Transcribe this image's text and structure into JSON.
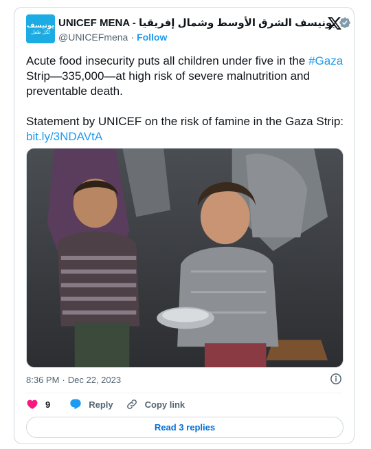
{
  "author": {
    "avatar": {
      "top_text": "يونيسف",
      "bottom_text": "لكل طفل",
      "logo_glyph": "☺",
      "bg_color": "#1cabe2"
    },
    "display_name": "UNICEF MENA - يونيسف الشرق الأوسط وشمال إفريقيا",
    "verified_icon": "verified-badge-icon",
    "handle": "@UNICEFmena",
    "separator": "·",
    "follow_label": "Follow"
  },
  "platform_icon": "x-logo-icon",
  "tweet": {
    "line1_before": "Acute food insecurity puts all children under five in the ",
    "hashtag": "#Gaza",
    "line1_after": " Strip—335,000—at high risk of severe malnutrition and preventable death.",
    "statement": "Statement by UNICEF on the risk of famine in the Gaza Strip: ",
    "link": "bit.ly/3NDAVtA"
  },
  "media": {
    "description_icon": "photo-children-with-bowl"
  },
  "meta": {
    "time": "8:36 PM",
    "separator": "·",
    "date": "Dec 22, 2023",
    "info_icon": "info-icon"
  },
  "actions": {
    "like_icon": "heart-icon",
    "likes": "9",
    "reply_icon": "reply-icon",
    "reply_label": "Reply",
    "copy_icon": "link-icon",
    "copy_label": "Copy link"
  },
  "read_replies_label": "Read 3 replies",
  "colors": {
    "accent": "#1d9bf0",
    "like": "#f91880",
    "text": "#0f1419",
    "muted": "#536471",
    "border": "#cfd9de",
    "replies": "#006fd6"
  }
}
